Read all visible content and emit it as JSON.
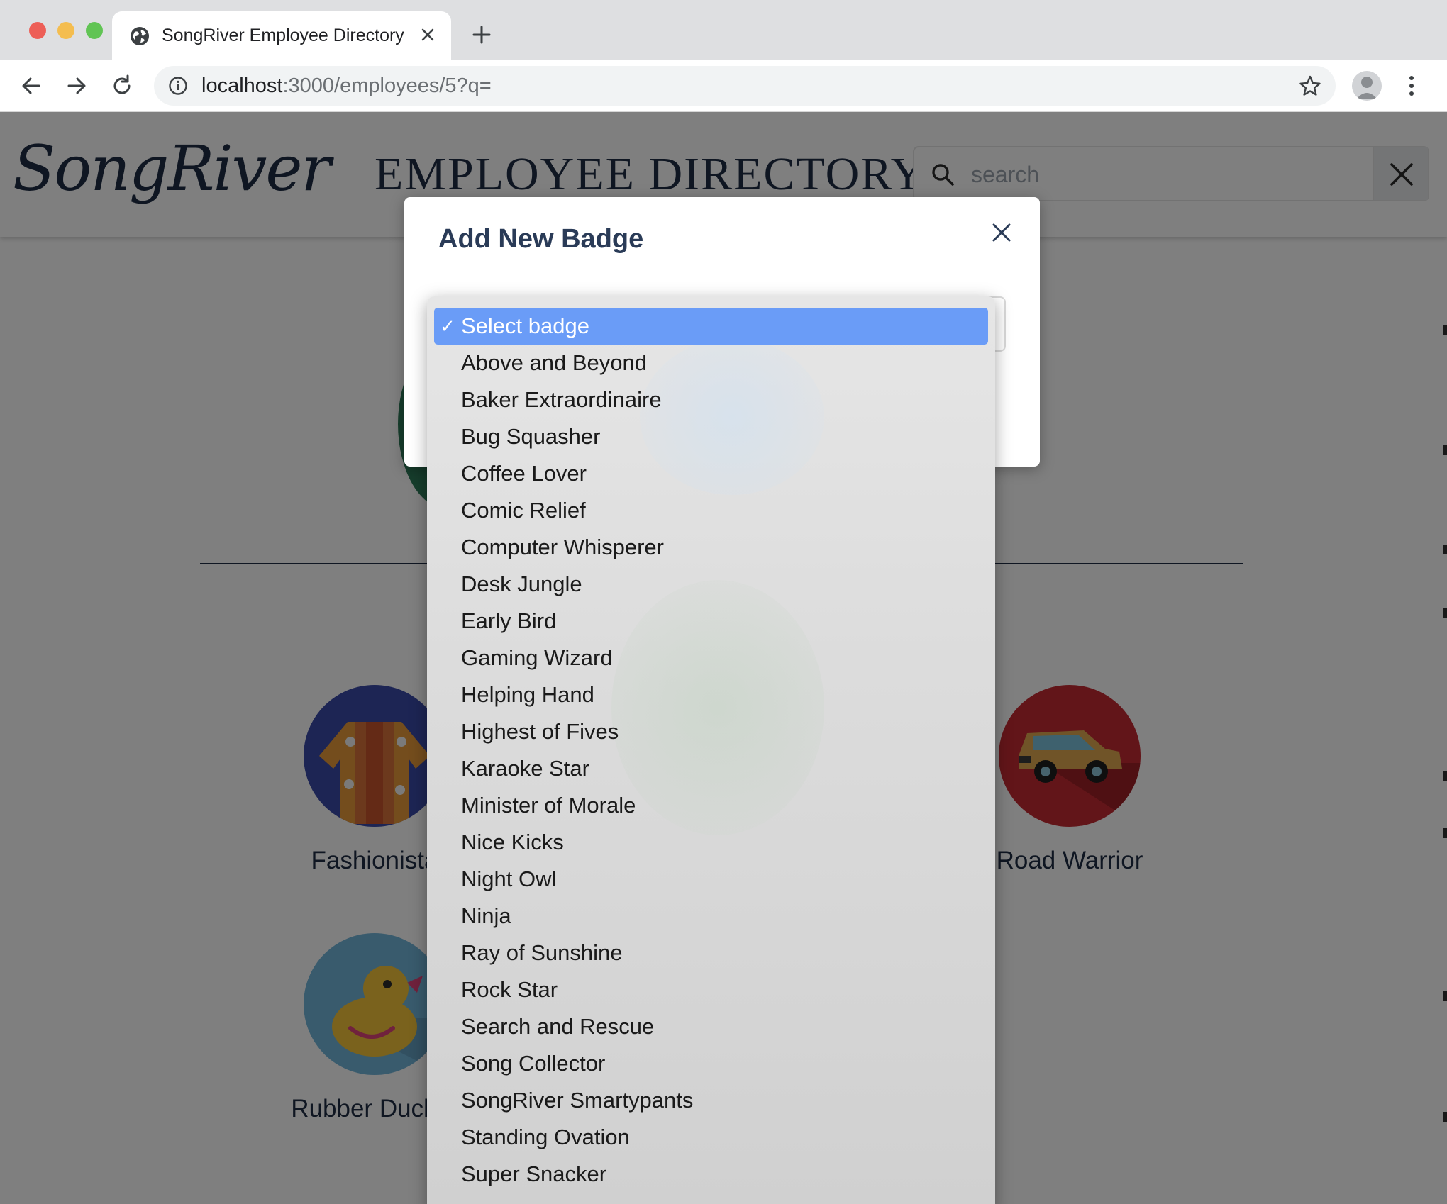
{
  "browser": {
    "tab_title": "SongRiver Employee Directory",
    "url_host": "localhost",
    "url_path": ":3000/employees/5?q="
  },
  "site": {
    "logo_text": "SongRiver",
    "title": "EMPLOYEE DIRECTORY",
    "search_placeholder": "search"
  },
  "badges": [
    {
      "label": "Fashionista"
    },
    {
      "label": "Road Warrior"
    },
    {
      "label": "Rubber Duck A"
    }
  ],
  "modal": {
    "title": "Add New Badge"
  },
  "dropdown": {
    "selected": "Select badge",
    "options": [
      "Select badge",
      "Above and Beyond",
      "Baker Extraordinaire",
      "Bug Squasher",
      "Coffee Lover",
      "Comic Relief",
      "Computer Whisperer",
      "Desk Jungle",
      "Early Bird",
      "Gaming Wizard",
      "Helping Hand",
      "Highest of Fives",
      "Karaoke Star",
      "Minister of Morale",
      "Nice Kicks",
      "Night Owl",
      "Ninja",
      "Ray of Sunshine",
      "Rock Star",
      "Search and Rescue",
      "Song Collector",
      "SongRiver Smartypants",
      "Standing Ovation",
      "Super Snacker"
    ]
  },
  "colors": {
    "brand_navy": "#1f2d44",
    "select_highlight": "#6a9cf7"
  }
}
